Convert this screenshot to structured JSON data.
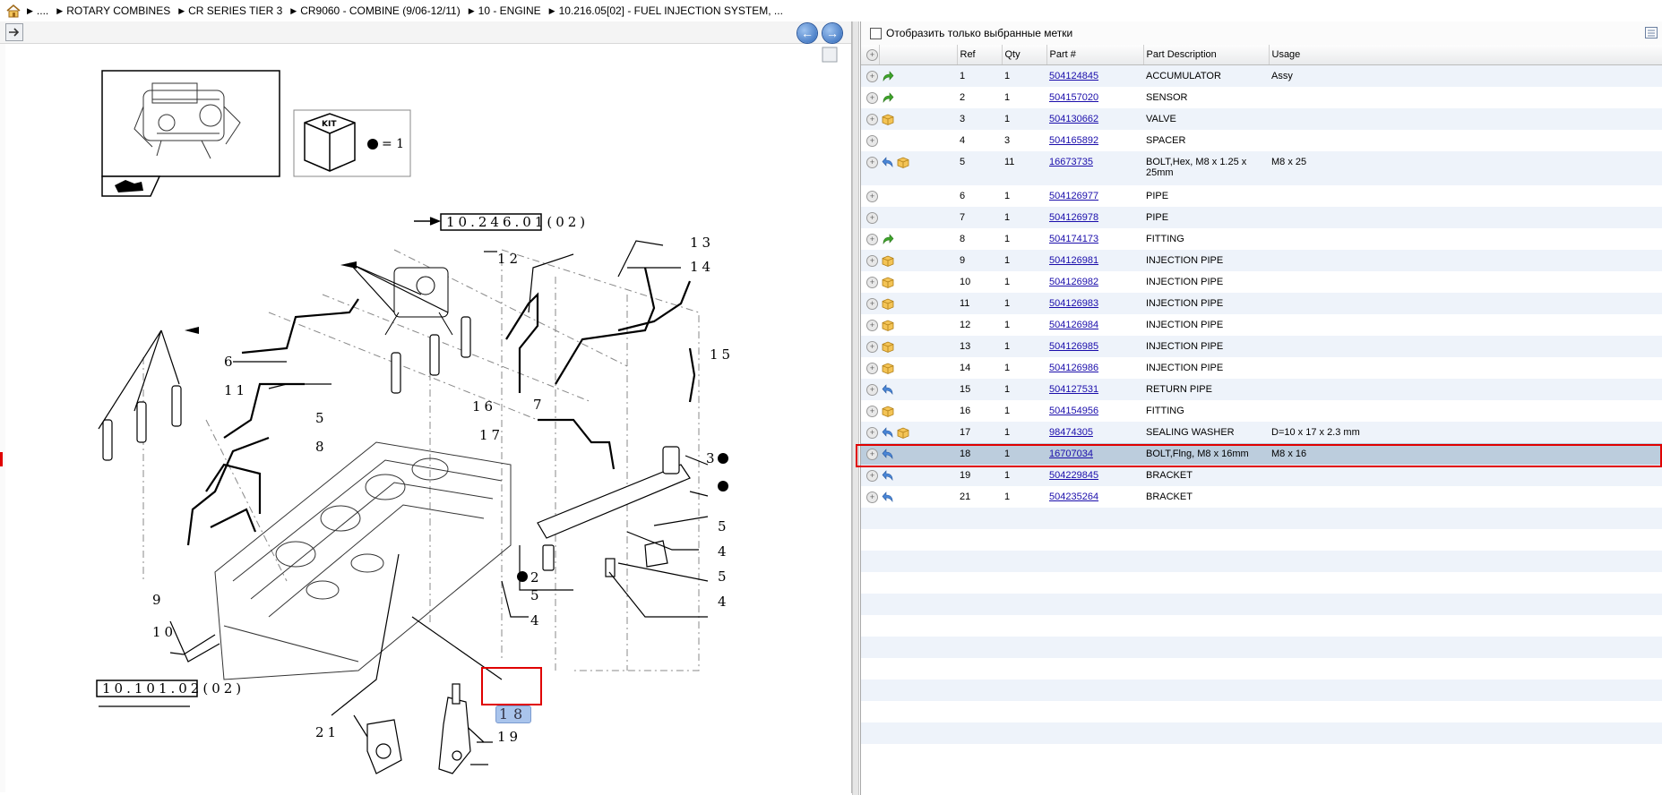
{
  "breadcrumb": [
    "....",
    "ROTARY COMBINES",
    "CR SERIES TIER 3",
    "CR9060 - COMBINE (9/06-12/11)",
    "10 - ENGINE",
    "10.216.05[02] - FUEL INJECTION SYSTEM, ..."
  ],
  "filter": {
    "label": "Отобразить только выбранные метки"
  },
  "columns": {
    "ref": "Ref",
    "qty": "Qty",
    "part": "Part #",
    "desc": "Part Description",
    "usage": "Usage"
  },
  "parts": [
    {
      "ref": "1",
      "qty": "1",
      "part": "504124845",
      "desc": "ACCUMULATOR",
      "usage": "Assy",
      "icons": [
        "green-arrow"
      ]
    },
    {
      "ref": "2",
      "qty": "1",
      "part": "504157020",
      "desc": "SENSOR",
      "usage": "",
      "icons": [
        "green-arrow"
      ]
    },
    {
      "ref": "3",
      "qty": "1",
      "part": "504130662",
      "desc": "VALVE",
      "usage": "",
      "icons": [
        "box"
      ]
    },
    {
      "ref": "4",
      "qty": "3",
      "part": "504165892",
      "desc": "SPACER",
      "usage": "",
      "icons": []
    },
    {
      "ref": "5",
      "qty": "11",
      "part": "16673735",
      "desc": "BOLT,Hex, M8 x 1.25 x 25mm",
      "usage": "M8 x 25",
      "icons": [
        "blue-arrow",
        "box"
      ]
    },
    {
      "ref": "6",
      "qty": "1",
      "part": "504126977",
      "desc": "PIPE",
      "usage": "",
      "icons": []
    },
    {
      "ref": "7",
      "qty": "1",
      "part": "504126978",
      "desc": "PIPE",
      "usage": "",
      "icons": []
    },
    {
      "ref": "8",
      "qty": "1",
      "part": "504174173",
      "desc": "FITTING",
      "usage": "",
      "icons": [
        "green-arrow"
      ]
    },
    {
      "ref": "9",
      "qty": "1",
      "part": "504126981",
      "desc": "INJECTION PIPE",
      "usage": "",
      "icons": [
        "box"
      ]
    },
    {
      "ref": "10",
      "qty": "1",
      "part": "504126982",
      "desc": "INJECTION PIPE",
      "usage": "",
      "icons": [
        "box"
      ]
    },
    {
      "ref": "11",
      "qty": "1",
      "part": "504126983",
      "desc": "INJECTION PIPE",
      "usage": "",
      "icons": [
        "box"
      ]
    },
    {
      "ref": "12",
      "qty": "1",
      "part": "504126984",
      "desc": "INJECTION PIPE",
      "usage": "",
      "icons": [
        "box"
      ]
    },
    {
      "ref": "13",
      "qty": "1",
      "part": "504126985",
      "desc": "INJECTION PIPE",
      "usage": "",
      "icons": [
        "box"
      ]
    },
    {
      "ref": "14",
      "qty": "1",
      "part": "504126986",
      "desc": "INJECTION PIPE",
      "usage": "",
      "icons": [
        "box"
      ]
    },
    {
      "ref": "15",
      "qty": "1",
      "part": "504127531",
      "desc": "RETURN PIPE",
      "usage": "",
      "icons": [
        "blue-arrow"
      ]
    },
    {
      "ref": "16",
      "qty": "1",
      "part": "504154956",
      "desc": "FITTING",
      "usage": "",
      "icons": [
        "box"
      ]
    },
    {
      "ref": "17",
      "qty": "1",
      "part": "98474305",
      "desc": "SEALING WASHER",
      "usage": "D=10 x 17 x 2.3 mm",
      "icons": [
        "blue-arrow",
        "box"
      ]
    },
    {
      "ref": "18",
      "qty": "1",
      "part": "16707034",
      "desc": "BOLT,Flng, M8 x 16mm",
      "usage": "M8 x 16",
      "icons": [
        "blue-arrow"
      ],
      "selected": true
    },
    {
      "ref": "19",
      "qty": "1",
      "part": "504229845",
      "desc": "BRACKET",
      "usage": "",
      "icons": [
        "blue-arrow"
      ]
    },
    {
      "ref": "21",
      "qty": "1",
      "part": "504235264",
      "desc": "BRACKET",
      "usage": "",
      "icons": [
        "blue-arrow"
      ]
    }
  ],
  "diagram": {
    "kit_label": "KIT",
    "kit_eq": "= 1",
    "ref_top": "10.246.01(02)",
    "ref_bottom": "10.101.02(02)",
    "callouts": [
      "13",
      "14",
      "12",
      "15",
      "6",
      "11",
      "5",
      "8",
      "16",
      "17",
      "7",
      "3",
      "5",
      "4",
      "5",
      "4",
      "2",
      "5",
      "4",
      "9",
      "10",
      "21",
      "19",
      "18"
    ]
  },
  "colors": {
    "selected_row": "#bccddd",
    "highlight_border": "#e00000",
    "link": "#1a0dab"
  }
}
